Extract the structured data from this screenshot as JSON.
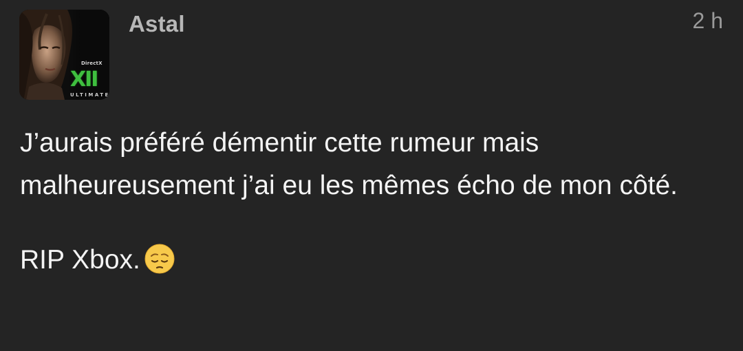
{
  "post": {
    "author": {
      "name": "Astal",
      "avatar_text": {
        "brand": "DirectX",
        "version": "XII",
        "edition": "ULTIMATE"
      }
    },
    "timestamp": "2 h",
    "paragraphs": [
      "J’aurais préféré démentir cette rumeur mais malheureusement j’ai eu les mêmes écho de mon côté.",
      "RIP Xbox."
    ],
    "emoji": "pensive-face-emoji"
  },
  "colors": {
    "background": "#242424",
    "username": "#b7b7b7",
    "timestamp": "#9a9a9a",
    "body_text": "#f4f4f4",
    "avatar_accent": "#3fbf3f"
  }
}
